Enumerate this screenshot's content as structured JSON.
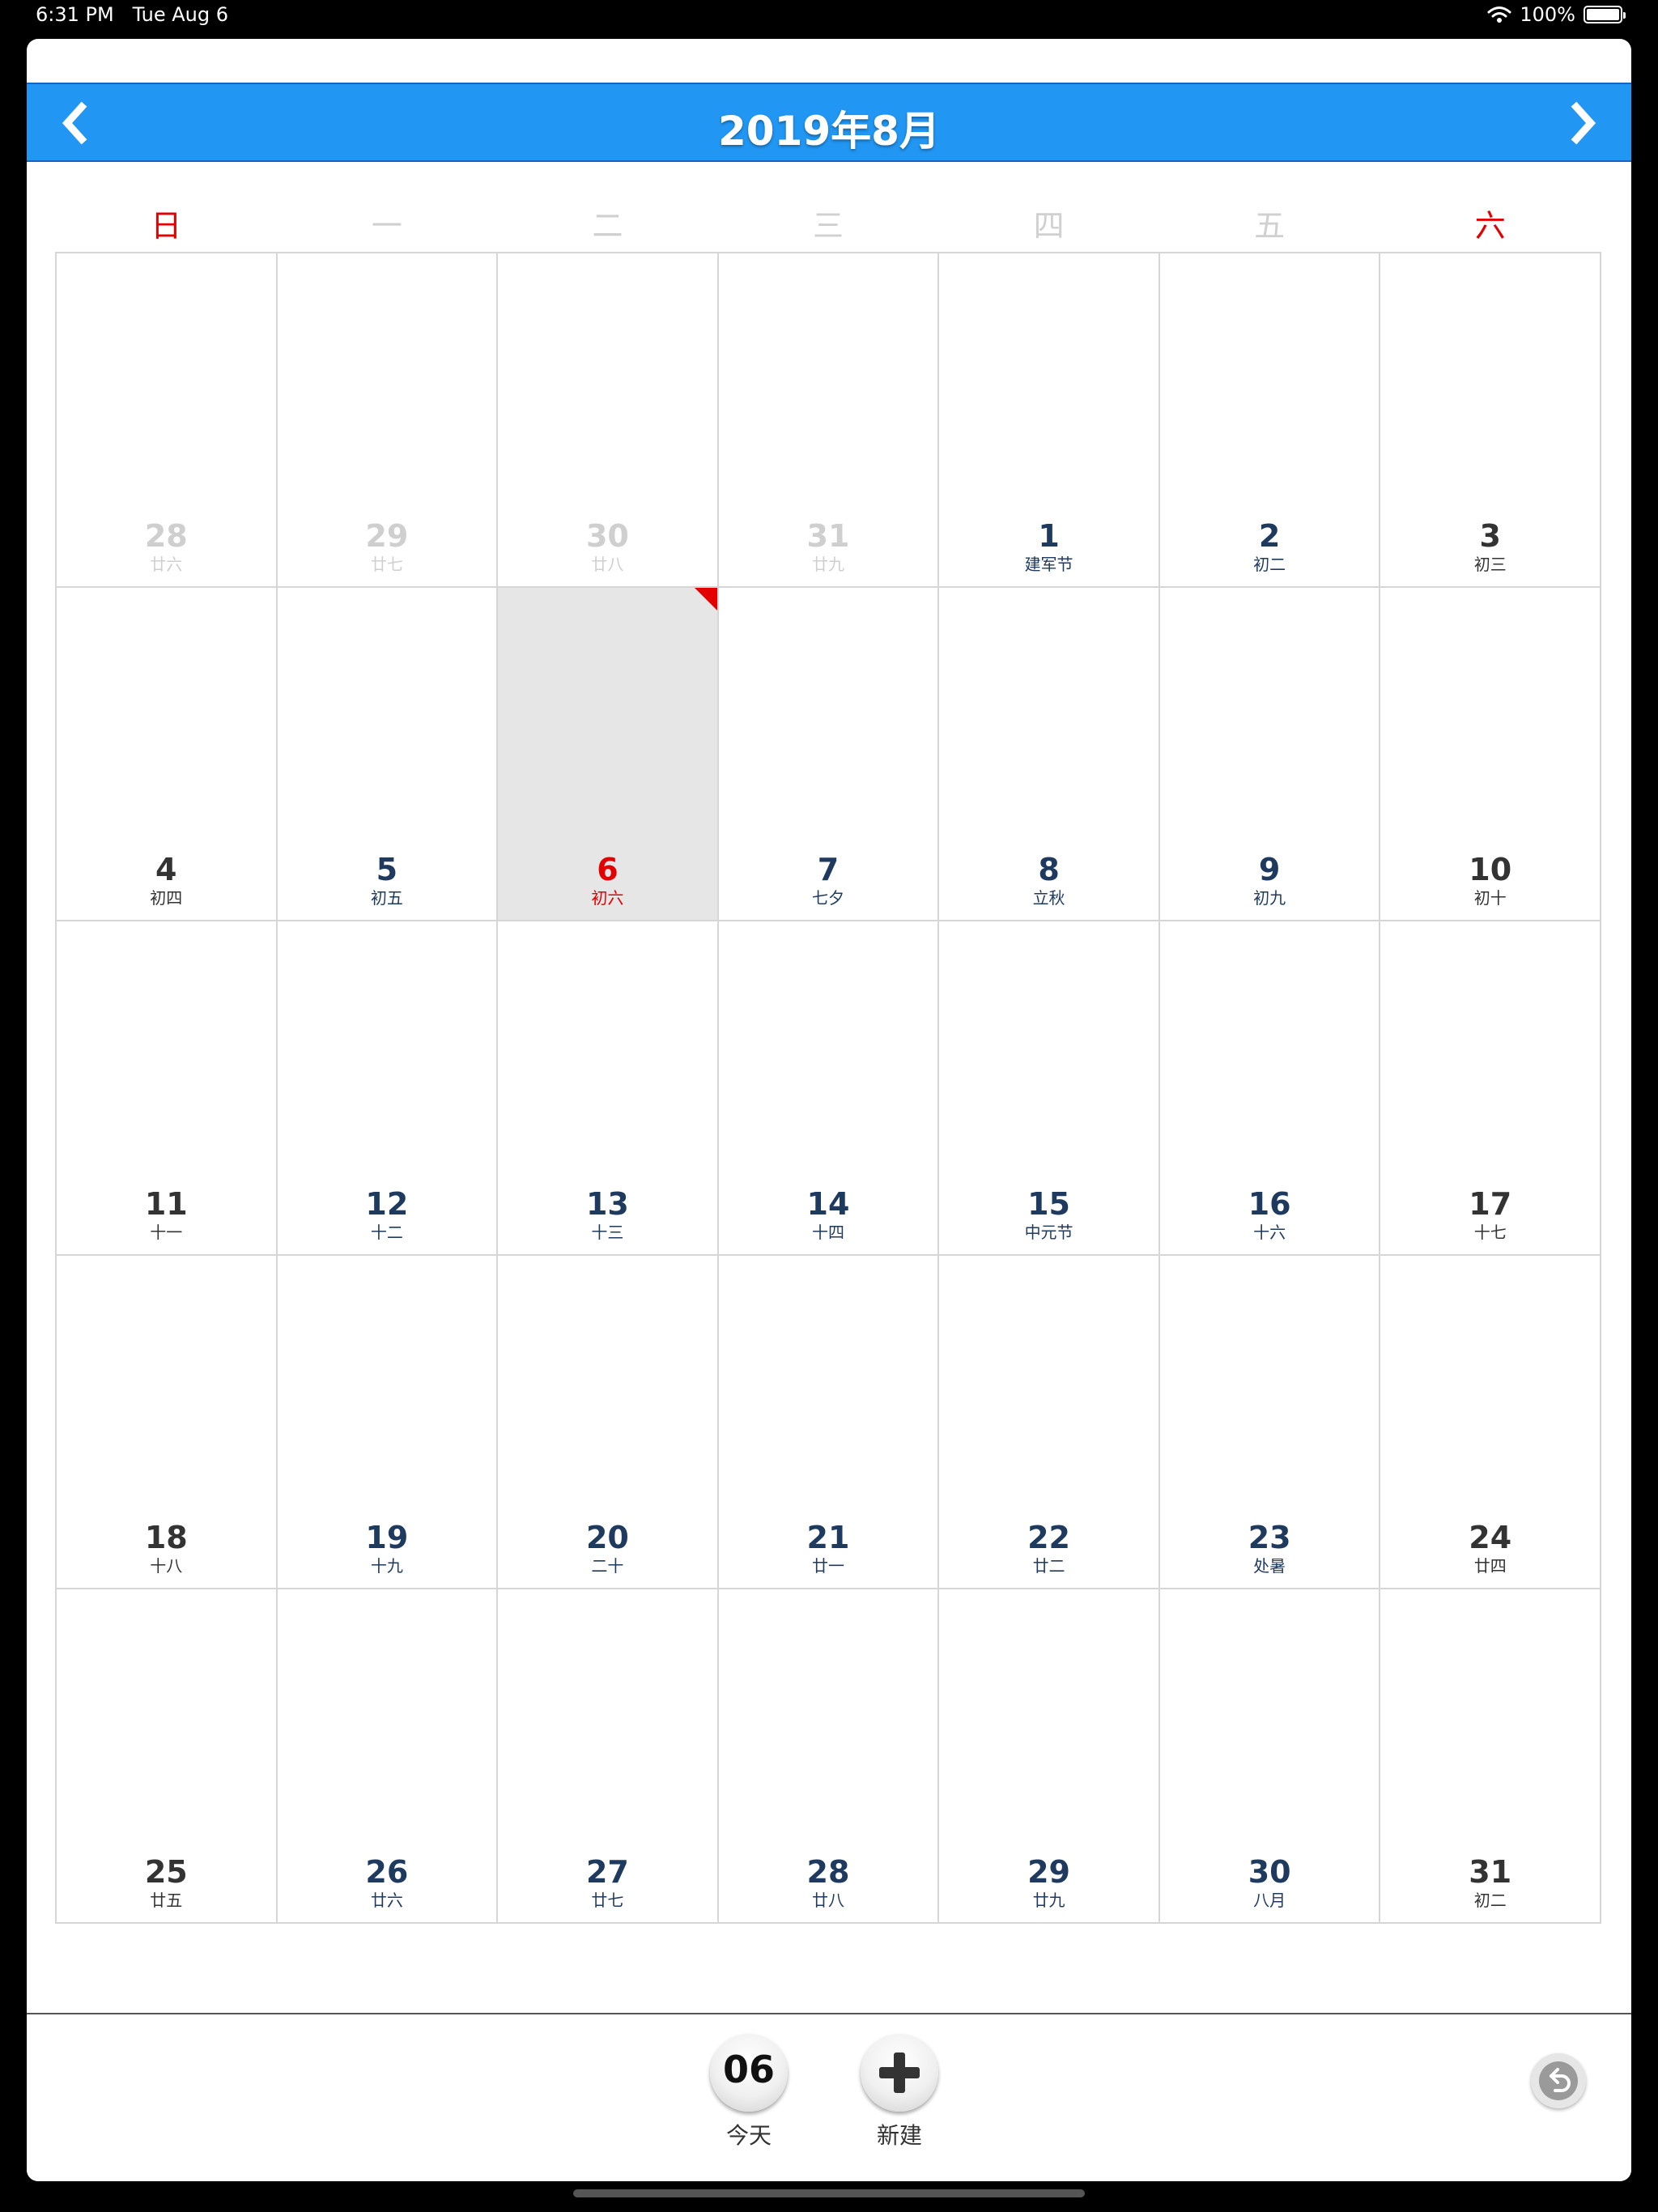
{
  "status_bar": {
    "time": "6:31 PM",
    "date": "Tue Aug 6",
    "battery": "100%",
    "battery_level": 1.0
  },
  "header": {
    "title": "2019年8月",
    "prev_icon": "chevron-left-icon",
    "next_icon": "chevron-right-icon"
  },
  "weekdays": [
    {
      "label": "日",
      "weekend": true
    },
    {
      "label": "一",
      "weekend": false
    },
    {
      "label": "二",
      "weekend": false
    },
    {
      "label": "三",
      "weekend": false
    },
    {
      "label": "四",
      "weekend": false
    },
    {
      "label": "五",
      "weekend": false
    },
    {
      "label": "六",
      "weekend": true
    }
  ],
  "weeks": [
    [
      {
        "day": "28",
        "lunar": "廿六",
        "other": true
      },
      {
        "day": "29",
        "lunar": "廿七",
        "other": true
      },
      {
        "day": "30",
        "lunar": "廿八",
        "other": true
      },
      {
        "day": "31",
        "lunar": "廿九",
        "other": true
      },
      {
        "day": "1",
        "lunar": "建军节"
      },
      {
        "day": "2",
        "lunar": "初二"
      },
      {
        "day": "3",
        "lunar": "初三"
      }
    ],
    [
      {
        "day": "4",
        "lunar": "初四"
      },
      {
        "day": "5",
        "lunar": "初五"
      },
      {
        "day": "6",
        "lunar": "初六",
        "today": true
      },
      {
        "day": "7",
        "lunar": "七夕"
      },
      {
        "day": "8",
        "lunar": "立秋"
      },
      {
        "day": "9",
        "lunar": "初九"
      },
      {
        "day": "10",
        "lunar": "初十"
      }
    ],
    [
      {
        "day": "11",
        "lunar": "十一"
      },
      {
        "day": "12",
        "lunar": "十二"
      },
      {
        "day": "13",
        "lunar": "十三"
      },
      {
        "day": "14",
        "lunar": "十四"
      },
      {
        "day": "15",
        "lunar": "中元节"
      },
      {
        "day": "16",
        "lunar": "十六"
      },
      {
        "day": "17",
        "lunar": "十七"
      }
    ],
    [
      {
        "day": "18",
        "lunar": "十八"
      },
      {
        "day": "19",
        "lunar": "十九"
      },
      {
        "day": "20",
        "lunar": "二十"
      },
      {
        "day": "21",
        "lunar": "廿一"
      },
      {
        "day": "22",
        "lunar": "廿二"
      },
      {
        "day": "23",
        "lunar": "处暑"
      },
      {
        "day": "24",
        "lunar": "廿四"
      }
    ],
    [
      {
        "day": "25",
        "lunar": "廿五"
      },
      {
        "day": "26",
        "lunar": "廿六"
      },
      {
        "day": "27",
        "lunar": "廿七"
      },
      {
        "day": "28",
        "lunar": "廿八"
      },
      {
        "day": "29",
        "lunar": "廿九"
      },
      {
        "day": "30",
        "lunar": "八月"
      },
      {
        "day": "31",
        "lunar": "初二"
      }
    ]
  ],
  "toolbar": {
    "today_number": "06",
    "today_label": "今天",
    "new_label": "新建",
    "new_icon": "plus-icon",
    "undo_icon": "undo-icon"
  },
  "colors": {
    "header": "#2196f3",
    "weekend_text": "#e30000",
    "day_text": "#1f3a5f",
    "other_month": "#cfcfcf",
    "today_bg": "#e6e6e6"
  }
}
